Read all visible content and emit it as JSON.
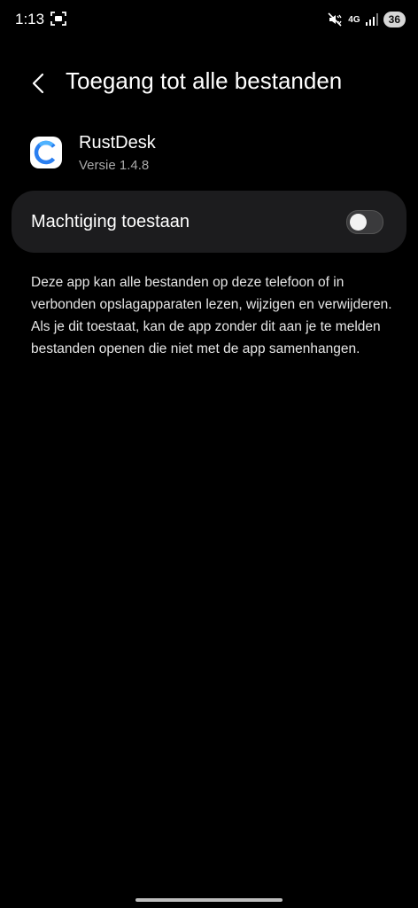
{
  "status_bar": {
    "time": "1:13",
    "network": "4G",
    "battery": "36",
    "icons": [
      "screen-recorder-icon",
      "mute-icon",
      "signal-icon"
    ]
  },
  "header": {
    "title": "Toegang tot alle bestanden",
    "back_icon": "chevron-left-icon"
  },
  "app": {
    "name": "RustDesk",
    "version": "Versie 1.4.8",
    "icon": "rustdesk-logo-icon"
  },
  "permission": {
    "label": "Machtiging toestaan",
    "enabled": false
  },
  "description": "Deze app kan alle bestanden op deze telefoon of in verbonden opslagapparaten lezen, wijzigen en verwijderen. Als je dit toestaat, kan de app zonder dit aan je te melden bestanden openen die niet met de app samenhangen.",
  "colors": {
    "background": "#000000",
    "card": "#1c1c1e",
    "accent": "#2a7ff0"
  }
}
